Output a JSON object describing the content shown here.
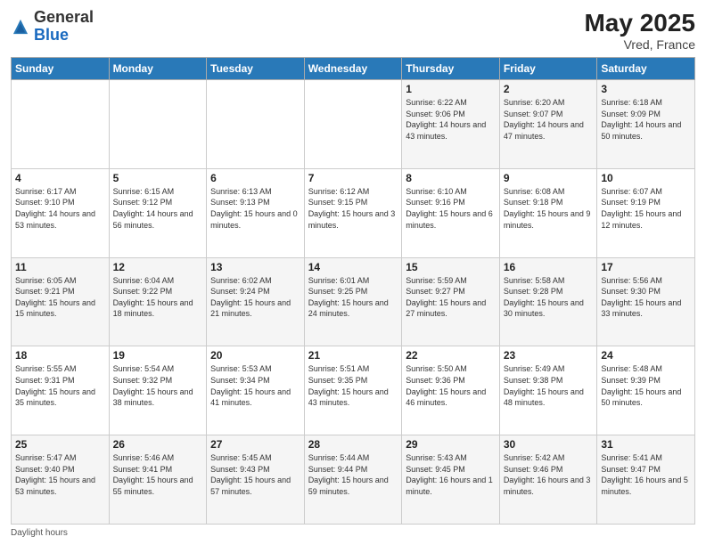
{
  "logo": {
    "general": "General",
    "blue": "Blue"
  },
  "header": {
    "month_year": "May 2025",
    "location": "Vred, France"
  },
  "days_of_week": [
    "Sunday",
    "Monday",
    "Tuesday",
    "Wednesday",
    "Thursday",
    "Friday",
    "Saturday"
  ],
  "weeks": [
    [
      {
        "day": "",
        "info": ""
      },
      {
        "day": "",
        "info": ""
      },
      {
        "day": "",
        "info": ""
      },
      {
        "day": "",
        "info": ""
      },
      {
        "day": "1",
        "sunrise": "Sunrise: 6:22 AM",
        "sunset": "Sunset: 9:06 PM",
        "daylight": "Daylight: 14 hours and 43 minutes."
      },
      {
        "day": "2",
        "sunrise": "Sunrise: 6:20 AM",
        "sunset": "Sunset: 9:07 PM",
        "daylight": "Daylight: 14 hours and 47 minutes."
      },
      {
        "day": "3",
        "sunrise": "Sunrise: 6:18 AM",
        "sunset": "Sunset: 9:09 PM",
        "daylight": "Daylight: 14 hours and 50 minutes."
      }
    ],
    [
      {
        "day": "4",
        "sunrise": "Sunrise: 6:17 AM",
        "sunset": "Sunset: 9:10 PM",
        "daylight": "Daylight: 14 hours and 53 minutes."
      },
      {
        "day": "5",
        "sunrise": "Sunrise: 6:15 AM",
        "sunset": "Sunset: 9:12 PM",
        "daylight": "Daylight: 14 hours and 56 minutes."
      },
      {
        "day": "6",
        "sunrise": "Sunrise: 6:13 AM",
        "sunset": "Sunset: 9:13 PM",
        "daylight": "Daylight: 15 hours and 0 minutes."
      },
      {
        "day": "7",
        "sunrise": "Sunrise: 6:12 AM",
        "sunset": "Sunset: 9:15 PM",
        "daylight": "Daylight: 15 hours and 3 minutes."
      },
      {
        "day": "8",
        "sunrise": "Sunrise: 6:10 AM",
        "sunset": "Sunset: 9:16 PM",
        "daylight": "Daylight: 15 hours and 6 minutes."
      },
      {
        "day": "9",
        "sunrise": "Sunrise: 6:08 AM",
        "sunset": "Sunset: 9:18 PM",
        "daylight": "Daylight: 15 hours and 9 minutes."
      },
      {
        "day": "10",
        "sunrise": "Sunrise: 6:07 AM",
        "sunset": "Sunset: 9:19 PM",
        "daylight": "Daylight: 15 hours and 12 minutes."
      }
    ],
    [
      {
        "day": "11",
        "sunrise": "Sunrise: 6:05 AM",
        "sunset": "Sunset: 9:21 PM",
        "daylight": "Daylight: 15 hours and 15 minutes."
      },
      {
        "day": "12",
        "sunrise": "Sunrise: 6:04 AM",
        "sunset": "Sunset: 9:22 PM",
        "daylight": "Daylight: 15 hours and 18 minutes."
      },
      {
        "day": "13",
        "sunrise": "Sunrise: 6:02 AM",
        "sunset": "Sunset: 9:24 PM",
        "daylight": "Daylight: 15 hours and 21 minutes."
      },
      {
        "day": "14",
        "sunrise": "Sunrise: 6:01 AM",
        "sunset": "Sunset: 9:25 PM",
        "daylight": "Daylight: 15 hours and 24 minutes."
      },
      {
        "day": "15",
        "sunrise": "Sunrise: 5:59 AM",
        "sunset": "Sunset: 9:27 PM",
        "daylight": "Daylight: 15 hours and 27 minutes."
      },
      {
        "day": "16",
        "sunrise": "Sunrise: 5:58 AM",
        "sunset": "Sunset: 9:28 PM",
        "daylight": "Daylight: 15 hours and 30 minutes."
      },
      {
        "day": "17",
        "sunrise": "Sunrise: 5:56 AM",
        "sunset": "Sunset: 9:30 PM",
        "daylight": "Daylight: 15 hours and 33 minutes."
      }
    ],
    [
      {
        "day": "18",
        "sunrise": "Sunrise: 5:55 AM",
        "sunset": "Sunset: 9:31 PM",
        "daylight": "Daylight: 15 hours and 35 minutes."
      },
      {
        "day": "19",
        "sunrise": "Sunrise: 5:54 AM",
        "sunset": "Sunset: 9:32 PM",
        "daylight": "Daylight: 15 hours and 38 minutes."
      },
      {
        "day": "20",
        "sunrise": "Sunrise: 5:53 AM",
        "sunset": "Sunset: 9:34 PM",
        "daylight": "Daylight: 15 hours and 41 minutes."
      },
      {
        "day": "21",
        "sunrise": "Sunrise: 5:51 AM",
        "sunset": "Sunset: 9:35 PM",
        "daylight": "Daylight: 15 hours and 43 minutes."
      },
      {
        "day": "22",
        "sunrise": "Sunrise: 5:50 AM",
        "sunset": "Sunset: 9:36 PM",
        "daylight": "Daylight: 15 hours and 46 minutes."
      },
      {
        "day": "23",
        "sunrise": "Sunrise: 5:49 AM",
        "sunset": "Sunset: 9:38 PM",
        "daylight": "Daylight: 15 hours and 48 minutes."
      },
      {
        "day": "24",
        "sunrise": "Sunrise: 5:48 AM",
        "sunset": "Sunset: 9:39 PM",
        "daylight": "Daylight: 15 hours and 50 minutes."
      }
    ],
    [
      {
        "day": "25",
        "sunrise": "Sunrise: 5:47 AM",
        "sunset": "Sunset: 9:40 PM",
        "daylight": "Daylight: 15 hours and 53 minutes."
      },
      {
        "day": "26",
        "sunrise": "Sunrise: 5:46 AM",
        "sunset": "Sunset: 9:41 PM",
        "daylight": "Daylight: 15 hours and 55 minutes."
      },
      {
        "day": "27",
        "sunrise": "Sunrise: 5:45 AM",
        "sunset": "Sunset: 9:43 PM",
        "daylight": "Daylight: 15 hours and 57 minutes."
      },
      {
        "day": "28",
        "sunrise": "Sunrise: 5:44 AM",
        "sunset": "Sunset: 9:44 PM",
        "daylight": "Daylight: 15 hours and 59 minutes."
      },
      {
        "day": "29",
        "sunrise": "Sunrise: 5:43 AM",
        "sunset": "Sunset: 9:45 PM",
        "daylight": "Daylight: 16 hours and 1 minute."
      },
      {
        "day": "30",
        "sunrise": "Sunrise: 5:42 AM",
        "sunset": "Sunset: 9:46 PM",
        "daylight": "Daylight: 16 hours and 3 minutes."
      },
      {
        "day": "31",
        "sunrise": "Sunrise: 5:41 AM",
        "sunset": "Sunset: 9:47 PM",
        "daylight": "Daylight: 16 hours and 5 minutes."
      }
    ]
  ],
  "footer": {
    "label": "Daylight hours"
  }
}
